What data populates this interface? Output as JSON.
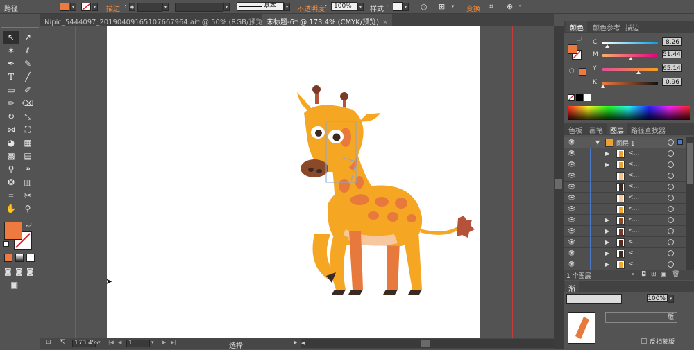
{
  "control_bar": {
    "object_label": "路径",
    "stroke_label": "描边",
    "stroke_profile": "基本",
    "opacity_label": "不透明度",
    "opacity_value": "100%",
    "style_label": "样式",
    "transform_label": "变换",
    "fill_color": "#ef7a3f"
  },
  "tabs": [
    {
      "label": "Nipic_5444097_20190409165107667964.ai* @ 50% (RGB/预览)",
      "close": "×"
    },
    {
      "label": "未标题-6* @ 173.4% (CMYK/预览)",
      "close": "×"
    }
  ],
  "color_panel": {
    "tabs": [
      "颜色",
      "颜色参考",
      "描边"
    ],
    "channels": [
      {
        "name": "C",
        "value": "8.26",
        "pct": 8.26
      },
      {
        "name": "M",
        "value": "51.44",
        "pct": 51.44
      },
      {
        "name": "Y",
        "value": "65.14",
        "pct": 65.14
      },
      {
        "name": "K",
        "value": "0.96",
        "pct": 0.96
      }
    ],
    "current_color": "#ef7a3f"
  },
  "layers_panel": {
    "tabs": [
      "色板",
      "画笔",
      "图层",
      "路径查找器"
    ],
    "top_layer": "图层 1",
    "sublayer_text": "<...",
    "rows": [
      {
        "thumb": "#f0a030",
        "expand": true
      },
      {
        "thumb": "#f0a030",
        "expand": true
      },
      {
        "thumb": "#f4c08a",
        "expand": false
      },
      {
        "thumb": "#3a2a22",
        "expand": false
      },
      {
        "thumb": "#f7c7a0",
        "expand": false
      },
      {
        "thumb": "#f2a830",
        "expand": false
      },
      {
        "thumb": "#8a4a2a",
        "expand": true
      },
      {
        "thumb": "#7a3a2a",
        "expand": true
      },
      {
        "thumb": "#5a2a1a",
        "expand": true
      },
      {
        "thumb": "#3a2a22",
        "expand": true
      },
      {
        "thumb": "#f2a830",
        "expand": true
      }
    ],
    "footer": "1 个图层"
  },
  "transparency_panel": {
    "tab_label": "渐",
    "opacity": "100%",
    "make_mask": "版",
    "invert_mask": "反相蒙版"
  },
  "status_bar": {
    "zoom": "173.4%",
    "page": "1",
    "tool": "选择"
  },
  "colors": {
    "accent": "#ef7a3f",
    "giraffe_body": "#f5a623",
    "giraffe_spots": "#e8793c",
    "guide": "#c43c3c"
  }
}
